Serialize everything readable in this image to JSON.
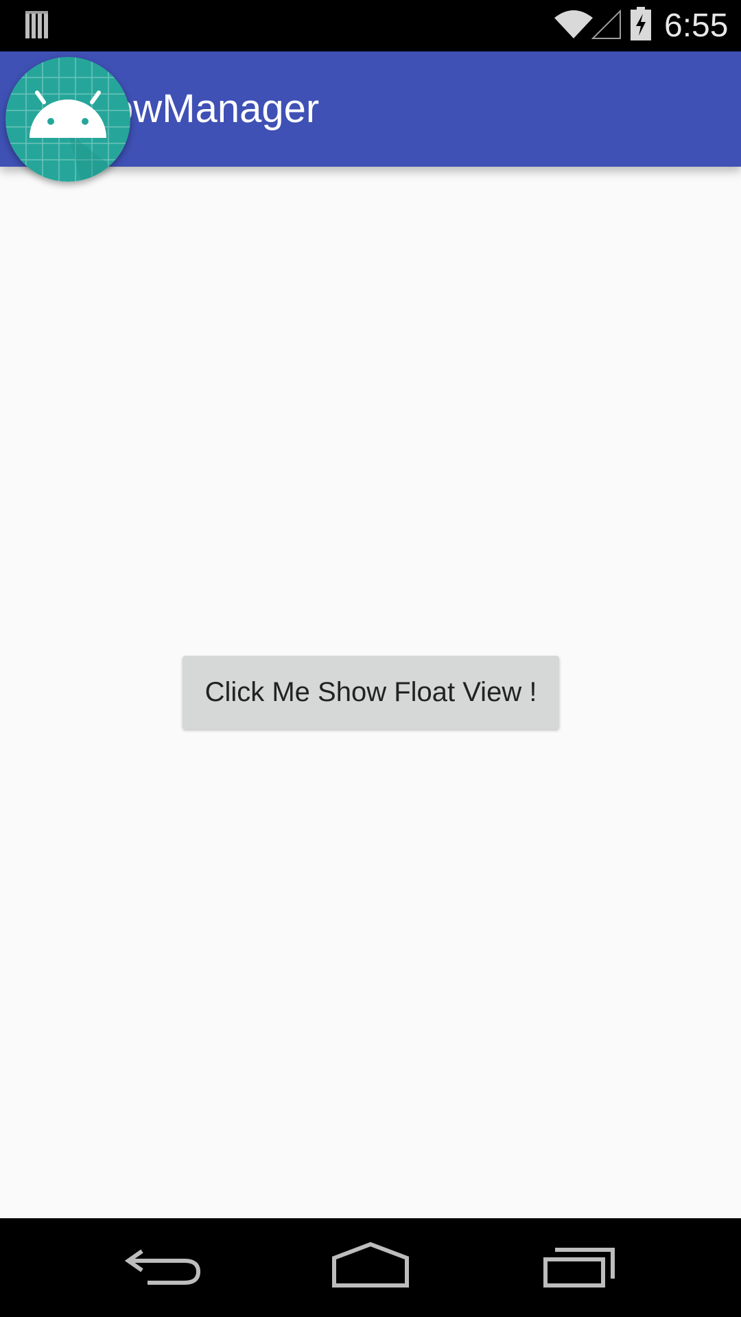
{
  "status_bar": {
    "time": "6:55",
    "icons": [
      "notification-icon",
      "wifi-icon",
      "signal-icon",
      "battery-charging-icon"
    ]
  },
  "app_bar": {
    "title": "WindowManager",
    "color": "#3f51b5"
  },
  "floating_view": {
    "icon": "android-launcher-icon",
    "color": "#26a69a"
  },
  "main": {
    "button_label": "Click Me Show Float View !"
  },
  "nav_bar": {
    "buttons": [
      "back-icon",
      "home-icon",
      "recents-icon"
    ]
  }
}
